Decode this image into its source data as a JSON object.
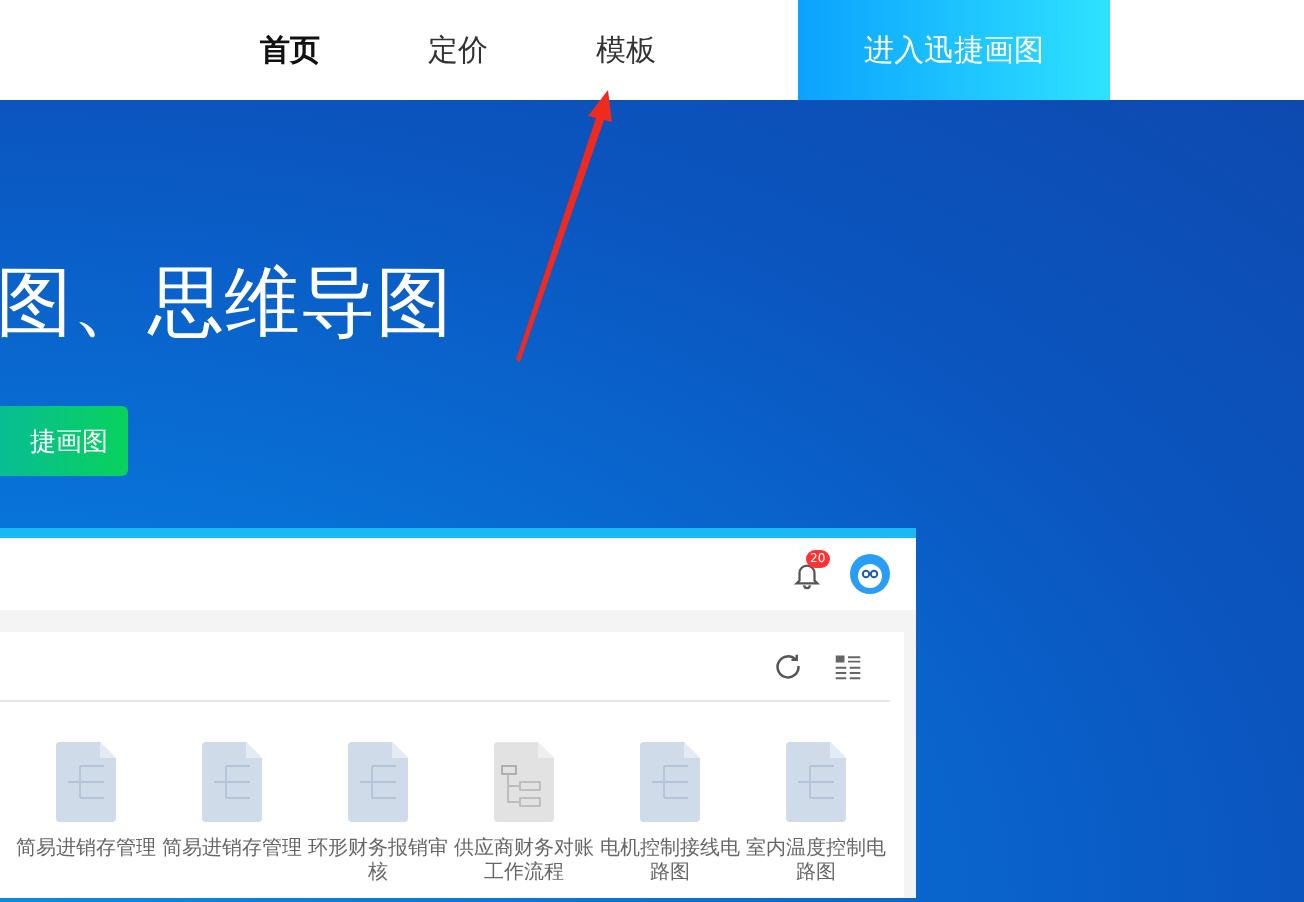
{
  "nav": {
    "items": [
      {
        "label": "首页",
        "selected": true
      },
      {
        "label": "定价",
        "selected": false
      },
      {
        "label": "模板",
        "selected": false
      }
    ],
    "cta": "进入迅捷画图"
  },
  "hero": {
    "title": "图、思维导图",
    "button": "捷画图"
  },
  "app": {
    "notifications": {
      "count": "20"
    },
    "templates": [
      {
        "name": "简易进销存管理",
        "kind": "tree"
      },
      {
        "name": "简易进销存管理",
        "kind": "tree"
      },
      {
        "name": "环形财务报销审核",
        "kind": "tree"
      },
      {
        "name": "供应商财务对账工作流程",
        "kind": "flow"
      },
      {
        "name": "电机控制接线电路图",
        "kind": "tree"
      },
      {
        "name": "室内温度控制电路图",
        "kind": "tree"
      }
    ]
  }
}
